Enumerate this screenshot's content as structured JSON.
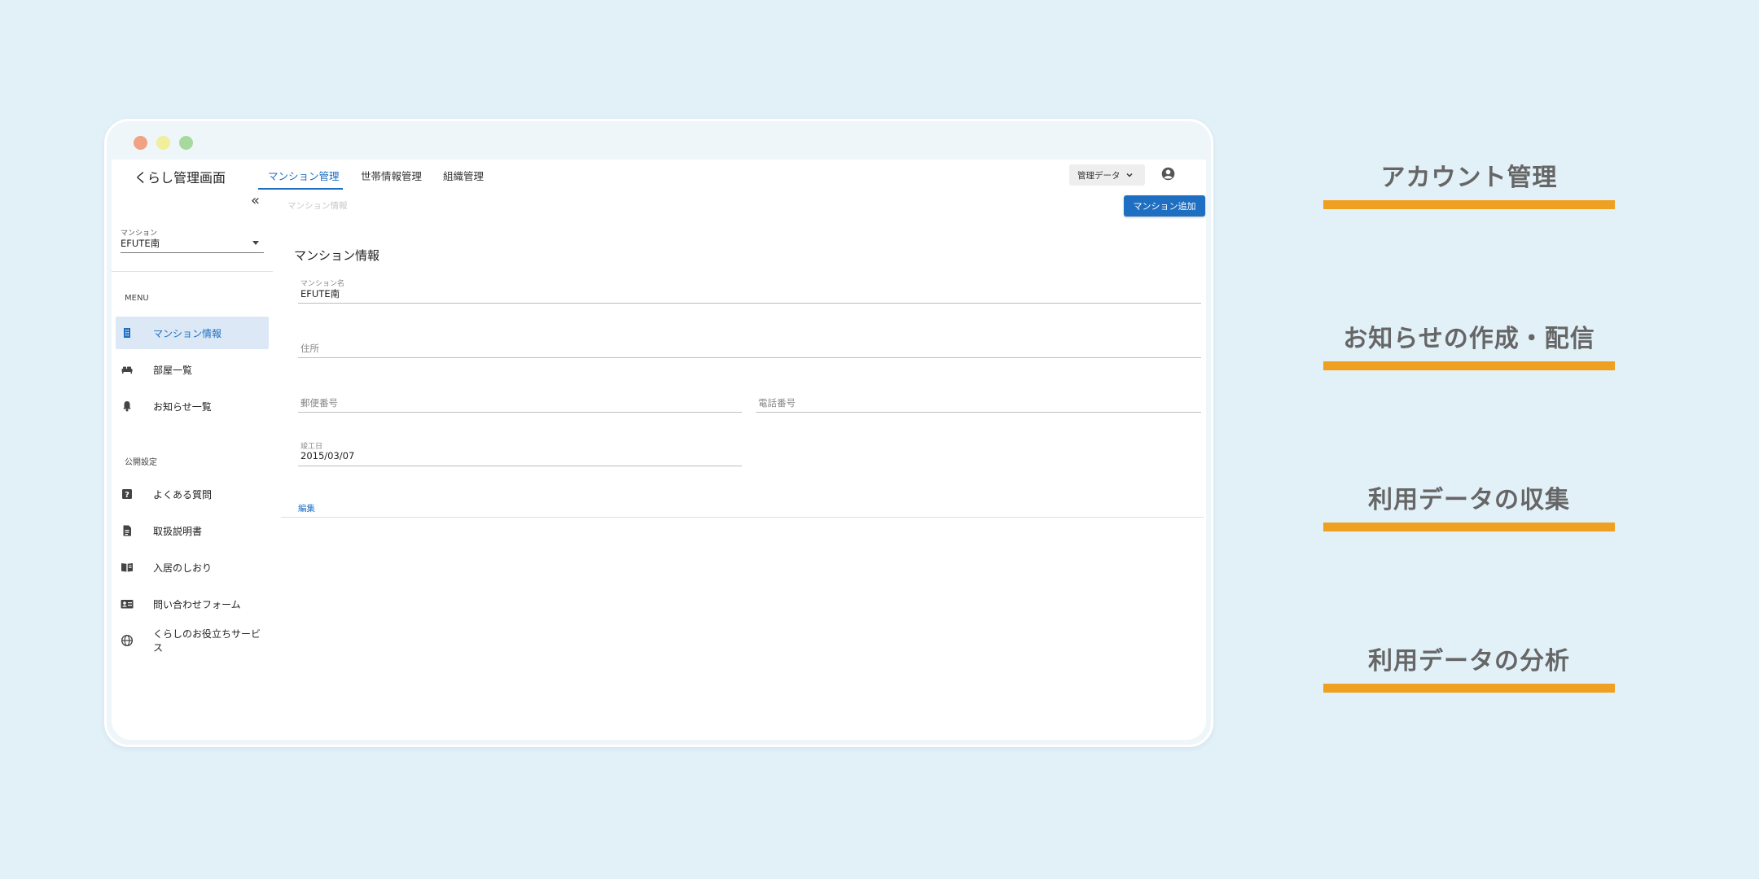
{
  "window": {
    "traffic_lights": {
      "red": "#f0a284",
      "yellow": "#f1ee9c",
      "green": "#a7d99f"
    }
  },
  "header": {
    "app_title": "くらし管理画面",
    "tabs": [
      {
        "label": "マンション管理",
        "active": true
      },
      {
        "label": "世帯情報管理",
        "active": false
      },
      {
        "label": "組織管理",
        "active": false
      }
    ],
    "data_select": "管理データ",
    "account_icon": "account-circle-icon"
  },
  "sidebar": {
    "mansion_label": "マンション",
    "mansion_value": "EFUTE南",
    "menu_label": "MENU",
    "menu_items": [
      {
        "label": "マンション情報",
        "icon": "building-icon",
        "active": true
      },
      {
        "label": "部屋一覧",
        "icon": "bed-icon",
        "active": false
      },
      {
        "label": "お知らせ一覧",
        "icon": "bell-icon",
        "active": false
      }
    ],
    "public_label": "公開設定",
    "public_items": [
      {
        "label": "よくある質問",
        "icon": "help-icon"
      },
      {
        "label": "取扱説明書",
        "icon": "document-icon"
      },
      {
        "label": "入居のしおり",
        "icon": "book-icon"
      },
      {
        "label": "問い合わせフォーム",
        "icon": "contact-card-icon"
      },
      {
        "label": "くらしのお役立ちサービス",
        "icon": "globe-icon"
      }
    ]
  },
  "main": {
    "breadcrumb": "マンション情報",
    "add_button": "マンション追加",
    "section_title": "マンション情報",
    "fields": {
      "name_label": "マンション名",
      "name_value": "EFUTE南",
      "address_placeholder": "住所",
      "postal_placeholder": "郵便番号",
      "phone_placeholder": "電話番号",
      "built_label": "竣工日",
      "built_value": "2015/03/07"
    },
    "edit_link": "編集"
  },
  "features": [
    "アカウント管理",
    "お知らせの作成・配信",
    "利用データの収集",
    "利用データの分析"
  ],
  "colors": {
    "accent": "#1e6fc2",
    "feature_bar": "#f0a020",
    "background": "#e2f0f8"
  }
}
